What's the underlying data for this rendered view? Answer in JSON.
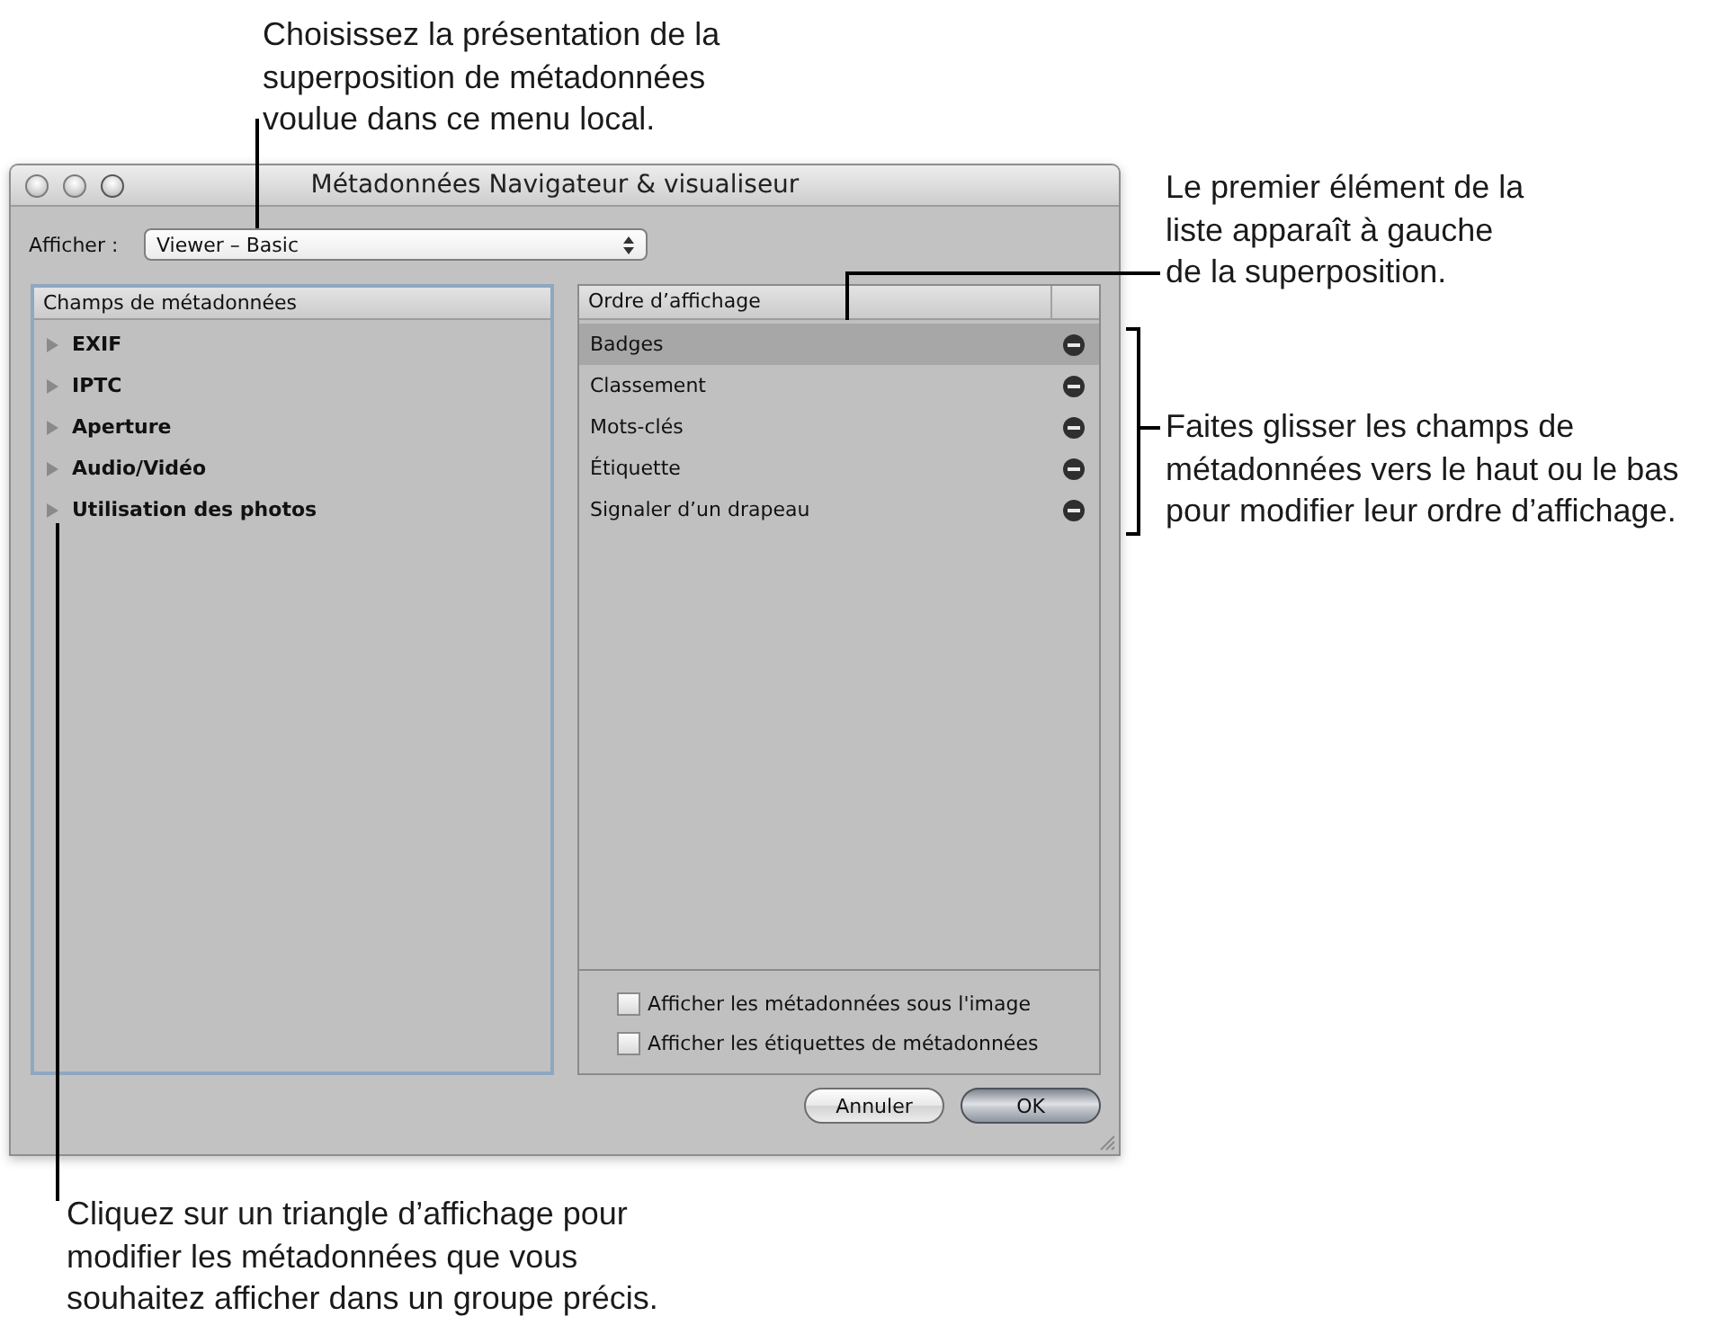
{
  "annotations": {
    "popup_note": "Choisissez la présentation de la\nsuperposition de métadonnées\nvoulue dans ce menu local.",
    "list_order_note": "Le premier élément de la\nliste apparaît à gauche\nde la superposition.",
    "drag_note": "Faites glisser les champs de\nmétadonnées vers le haut ou le bas\npour modifier leur ordre d’affichage.",
    "triangle_note": "Cliquez sur un triangle d’affichage pour\nmodifier les métadonnées que vous\nsouhaitez afficher dans un groupe précis."
  },
  "window": {
    "title": "Métadonnées Navigateur & visualiseur"
  },
  "show_menu": {
    "label": "Afficher :",
    "value": "Viewer – Basic"
  },
  "fields_panel": {
    "header": "Champs de métadonnées",
    "items": [
      {
        "label": "EXIF",
        "expanded": false
      },
      {
        "label": "IPTC",
        "expanded": false
      },
      {
        "label": "Aperture",
        "expanded": false
      },
      {
        "label": "Audio/Vidéo",
        "expanded": false
      },
      {
        "label": "Utilisation des photos",
        "expanded": false
      }
    ]
  },
  "order_panel": {
    "header": "Ordre d’affichage",
    "items": [
      {
        "label": "Badges",
        "selected": true
      },
      {
        "label": "Classement",
        "selected": false
      },
      {
        "label": "Mots-clés",
        "selected": false
      },
      {
        "label": "Étiquette",
        "selected": false
      },
      {
        "label": "Signaler d’un drapeau",
        "selected": false
      }
    ],
    "options": [
      {
        "label": "Afficher les métadonnées sous l'image",
        "checked": false
      },
      {
        "label": "Afficher les étiquettes de métadonnées",
        "checked": false
      }
    ]
  },
  "buttons": [
    {
      "label": "Annuler",
      "default": false
    },
    {
      "label": "OK",
      "default": true
    }
  ]
}
